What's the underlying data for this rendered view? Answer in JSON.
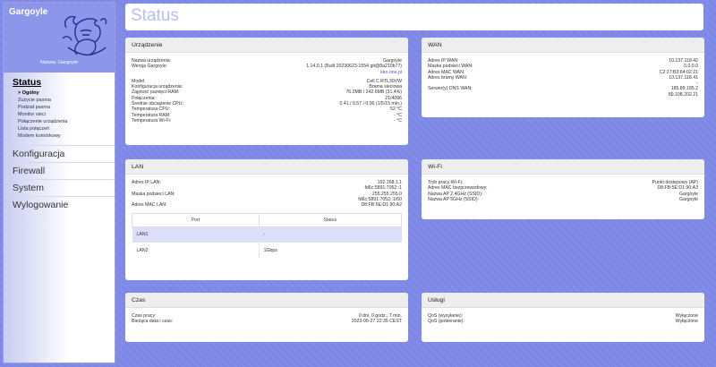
{
  "brand": {
    "title": "Gargoyle",
    "device_label": "Nazwa: Gargoyle",
    "logo_icon": "gargoyle-logo-icon"
  },
  "nav": {
    "status": "Status",
    "status_sub": [
      "> Ogólny",
      "Zużycie pasma",
      "Podział pasma",
      "Monitor sieci",
      "Połączenie urządzenia",
      "Lista połączeń",
      "Modem komórkowy"
    ],
    "konfiguracja": "Konfiguracja",
    "firewall": "Firewall",
    "system": "System",
    "wylogowanie": "Wylogowanie"
  },
  "page": {
    "title": "Status"
  },
  "urzadzenie": {
    "title": "Urządzenie",
    "name_k": "Nazwa urządzenia:",
    "name_v": "Gargoyle",
    "ver_k": "Wersja Gargoyle:",
    "ver_v": "1.14.0.1 (Built 20230623-1554 git@8a210b77)",
    "ver_link": "eko.one.pl",
    "model_k": "Model:",
    "model_v": "Cell C RTL30VW",
    "conf_k": "Konfiguracja urządzenia:",
    "conf_v": "Brama sieciowa",
    "ram_k": "Zajętość pamięci RAM:",
    "ram_v": "76.2MB / 242.6MB (31.4%)",
    "conn_k": "Połączenia:",
    "conn_v": "21/4096",
    "load_k": "Średnie obciążenie CPU:",
    "load_v": "0.41 / 0.57 / 0.36 (1/5/15 min.)",
    "tcpu_k": "Temperatura CPU:",
    "tcpu_v": "52 °C",
    "tram_k": "Temperatura RAM:",
    "tram_v": "- °C",
    "twifi_k": "Temperatura Wi-Fi:",
    "twifi_v": "- °C"
  },
  "wan": {
    "title": "WAN",
    "ip_k": "Adres IP WAN:",
    "ip_v": "10.137.118.42",
    "mask_k": "Maska podsieci WAN:",
    "mask_v": "0.0.0.0",
    "mac_k": "Adres MAC WAN:",
    "mac_v": "C2:27:B3:64:02:21",
    "gw_k": "Adres bramy WAN:",
    "gw_v": "10.137.118.41",
    "dash": "-",
    "dns_k": "Serwer(y) DNS WAN:",
    "dns_v1": "185.89.185.2",
    "dns_v2": "89.108.202.21"
  },
  "lan": {
    "title": "LAN",
    "ip_k": "Adres IP LAN:",
    "ip_v1": "192.168.1.1",
    "ip_v2": "fd6c:5891:7052::1",
    "mask_k": "Maska podsieci LAN:",
    "mask_v1": "255.255.255.0",
    "mask_v2": "fd6c:5891:7052::1/60",
    "mac_k": "Adres MAC LAN:",
    "mac_v": "D8:FB:5E:D1:90:A2",
    "col_port": "Port",
    "col_status": "Status",
    "rows": [
      {
        "port": "LAN1",
        "status": "-"
      },
      {
        "port": "LAN2",
        "status": "1Gbps"
      }
    ]
  },
  "wifi": {
    "title": "Wi-Fi",
    "mode_k": "Tryb pracy Wi-Fi:",
    "mode_v": "Punkt dostępowy (AP)",
    "mac_k": "Adres MAC bezprzewodowy:",
    "mac_v": "D8:FB:5E:D1:90:A3",
    "ap24_k": "Nazwa AP 2.4GHz (SSID):",
    "ap24_v": "Gargoyle",
    "ap5_k": "Nazwa AP 5GHz (SSID):",
    "ap5_v": "Gargoyle"
  },
  "czas": {
    "title": "Czas",
    "up_k": "Czas pracy:",
    "up_v": "0 dni, 0 godz., 7 min.",
    "now_k": "Bieżąca data i czas:",
    "now_v": "2023-06-27 22:35 CEST"
  },
  "uslugi": {
    "title": "Usługi",
    "qosup_k": "QoS (wysyłanie):",
    "qosup_v": "Wyłączone",
    "qosdn_k": "QoS (pobieranie):",
    "qosdn_v": "Wyłączone"
  },
  "colors": {
    "background": "#7e88e6",
    "brand": "#8c96ea",
    "title": "#b8bff2",
    "link": "#3a5fcd",
    "row_highlight": "#dcdffa"
  }
}
